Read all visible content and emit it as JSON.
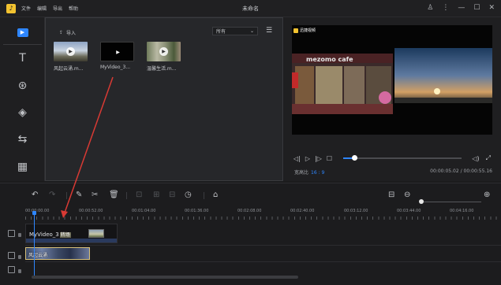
{
  "app": {
    "logo_glyph": "♪",
    "title": "未命名",
    "menu": [
      "文件",
      "编辑",
      "导出",
      "帮助"
    ],
    "window_controls": {
      "user": "♙",
      "more": "⋮",
      "minimize": "—",
      "maximize": "☐",
      "close": "✕"
    }
  },
  "rail": {
    "items": [
      {
        "name": "media",
        "icon": "play-icon",
        "glyph": "▶"
      },
      {
        "name": "text",
        "icon": "text-icon",
        "glyph": "T"
      },
      {
        "name": "filter",
        "icon": "filter-icon",
        "glyph": "⊛"
      },
      {
        "name": "overlay",
        "icon": "layers-icon",
        "glyph": "◈"
      },
      {
        "name": "transition",
        "icon": "transition-icon",
        "glyph": "⇆"
      },
      {
        "name": "element",
        "icon": "film-icon",
        "glyph": "▦"
      }
    ]
  },
  "library": {
    "import_label": "导入",
    "filter_value": "所有",
    "filter_arrow": "⌄",
    "list_icon": "☰",
    "items": [
      {
        "label": "风起云涌.m...",
        "play": "▶"
      },
      {
        "label": "MyVideo_3...",
        "play": "▶"
      },
      {
        "label": "温馨生活.m...",
        "play": "▶"
      }
    ]
  },
  "preview": {
    "watermark": "迅捷视频",
    "shop_sign": "mezomo cafe",
    "controls": {
      "prev": "◁|",
      "play": "▷",
      "next": "|▷",
      "stop": "☐",
      "volume": "◁)",
      "fullscreen": "⤢"
    },
    "progress": 0.09,
    "aspect_label": "宽高比",
    "aspect_value": "16 : 9",
    "timecode": "00:00:05.02 / 00:00:55.16"
  },
  "timeline": {
    "ruler": [
      "00:00:00.00",
      "00:00:52.00",
      "00:01:04.00",
      "00:01:36.00",
      "00:02:08.00",
      "00:02:40.00",
      "00:03:12.00",
      "00:03:44.00",
      "00:04:16.00"
    ],
    "tools": {
      "undo": "↶",
      "redo": "↷",
      "edit": "✎",
      "cut": "✂",
      "delete": "🗑",
      "crop": "⊡",
      "split": "⊞",
      "rotate": "⊟",
      "speed": "◷",
      "mark": "⌂",
      "fit": "⊟",
      "zoom_out": "⊖",
      "zoom_in": "⊕"
    },
    "video_clip": {
      "name": "MyVideo_3",
      "badge": "转场"
    },
    "image_clip": {
      "name": "风起云涌"
    }
  },
  "colors": {
    "accent": "#2e86ff",
    "annotation": "#d83a34",
    "background": "#1b1b1d",
    "panel": "#26272a"
  }
}
